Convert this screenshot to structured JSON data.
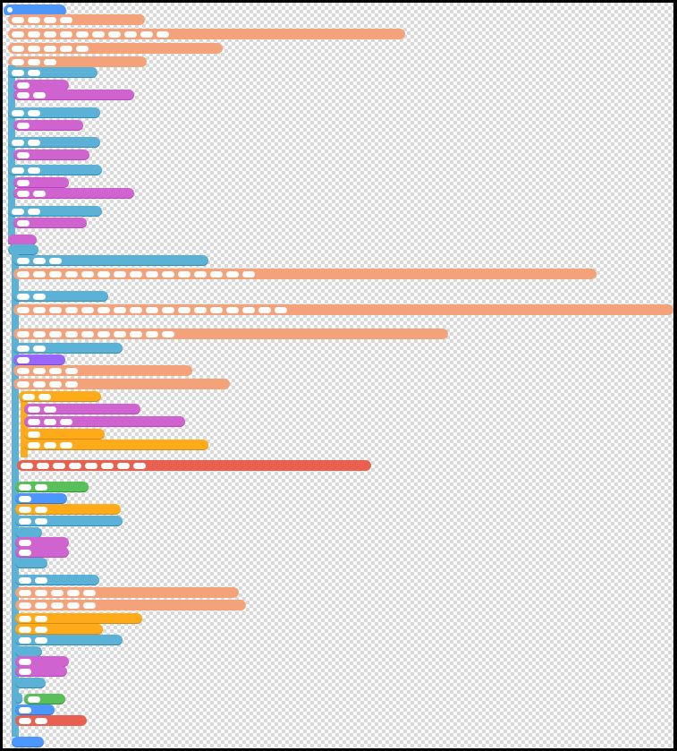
{
  "canvas": {
    "background": "transparent-checkerboard",
    "header_text": "",
    "footer_text": ""
  },
  "colors": {
    "motion": "#4c97ff",
    "sensing": "#5cb1d6",
    "control": "#ffab19",
    "operators": "#59c059",
    "variables": "#ff8c1a",
    "looks": "#9966ff",
    "pink_custom": "#cf63cf",
    "salmon": "#f3a27a",
    "myblocks_red": "#ff6680"
  },
  "icons": {
    "hat": "flag-icon"
  }
}
